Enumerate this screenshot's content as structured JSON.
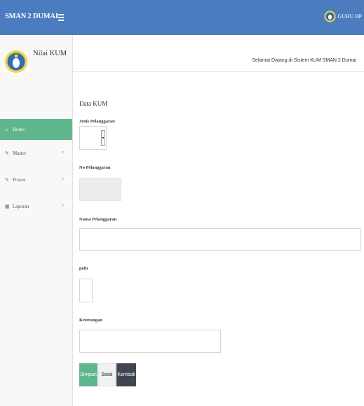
{
  "topbar": {
    "brand": "SMAN 2 DUMAI",
    "user_name": "GURU BP"
  },
  "sidebar": {
    "title": "Nilai KUM",
    "items": [
      {
        "label": "Home",
        "icon": "home-icon",
        "active": true
      },
      {
        "label": "Master",
        "icon": "pencil-icon",
        "chevron": "v"
      },
      {
        "label": "Proses",
        "icon": "pencil-icon",
        "chevron": "v"
      },
      {
        "label": "Laporan",
        "icon": "table-icon",
        "chevron": "v"
      }
    ]
  },
  "header": {
    "welcome": "Selamat Datang di Sistem KUM SMAN 2 Dumai"
  },
  "main": {
    "page_title": "Data KUM",
    "fields": {
      "jenis": {
        "label": "Jenis Pelanggaran",
        "value": ""
      },
      "no": {
        "label": "No Pelanggaran",
        "value": ""
      },
      "nama": {
        "label": "Nama Pelanggaran",
        "value": ""
      },
      "poin": {
        "label": "poin",
        "value": ""
      },
      "keterangan": {
        "label": "Keterangan",
        "value": ""
      }
    },
    "buttons": {
      "save": "Simpan",
      "cancel": "Batal",
      "back": "Kembali"
    }
  },
  "colors": {
    "topbar": "#4a7cbf",
    "accent": "#5fb58c",
    "dark_button": "#3f4652"
  }
}
